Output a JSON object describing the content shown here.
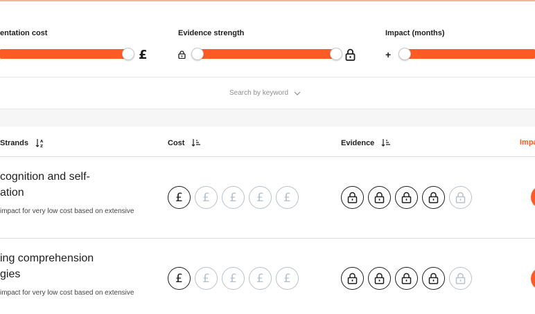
{
  "filters": {
    "cost": {
      "label": "entation cost",
      "symbol": "£"
    },
    "evidence": {
      "label": "Evidence strength"
    },
    "impact": {
      "label": "Impact (months)",
      "symbol": "+"
    },
    "search": {
      "placeholder": "Search by keyword"
    }
  },
  "table": {
    "headers": {
      "strands": "Strands",
      "cost": "Cost",
      "evidence": "Evidence",
      "impact": "Impa"
    },
    "rows": [
      {
        "title_line1": "cognition and self-",
        "title_line2": "ation",
        "description": "impact for very low cost based on extensive",
        "cost_level": 1,
        "cost_max": 5,
        "evidence_level": 4,
        "evidence_max": 5
      },
      {
        "title_line1": "ing comprehension",
        "title_line2": "gies",
        "description": "impact for very low cost based on extensive",
        "cost_level": 1,
        "cost_max": 5,
        "evidence_level": 4,
        "evidence_max": 5
      }
    ],
    "cost_symbol": "£"
  },
  "colors": {
    "accent": "#fe5a24",
    "active_icon": "#1d1d1f",
    "inactive_icon": "#b8c2ca"
  },
  "icons": [
    "lock-icon",
    "sort-alpha-icon",
    "sort-amount-icon",
    "chevron-down-icon",
    "pound-icon"
  ]
}
